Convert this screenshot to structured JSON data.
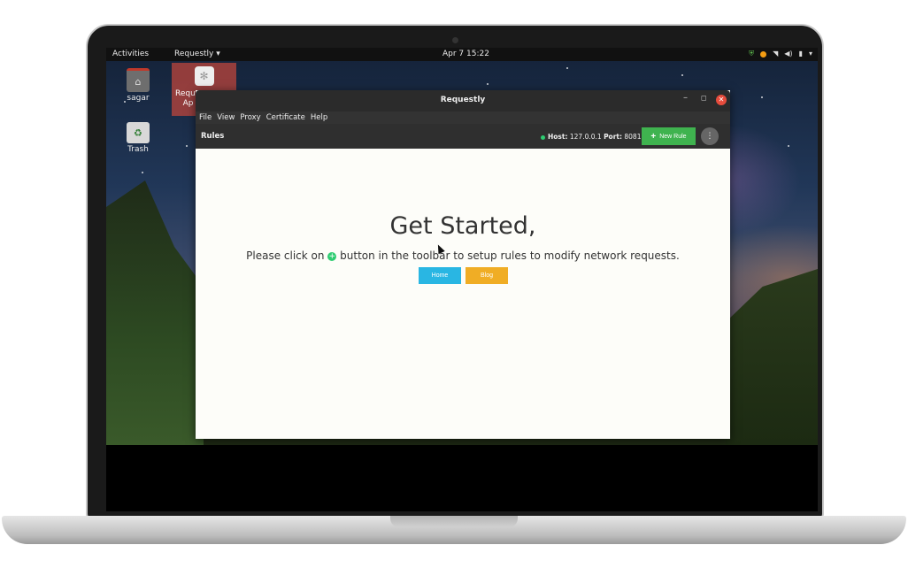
{
  "topbar": {
    "activities": "Activities",
    "app_menu": "Requestly ▾",
    "clock": "Apr 7  15:22"
  },
  "tray_icons": [
    "shield-icon",
    "orange-dot-icon",
    "wifi-icon",
    "volume-icon",
    "battery-icon",
    "chevron-down-icon"
  ],
  "desktop": {
    "icons": [
      {
        "label": "sagar",
        "icon": "home-folder-icon"
      },
      {
        "label": "Trash",
        "icon": "trash-icon"
      }
    ],
    "selected_icon": {
      "label": "Reque\nAp",
      "icon": "requestly-app-icon"
    }
  },
  "window": {
    "title": "Requestly",
    "menu": [
      "File",
      "View",
      "Proxy",
      "Certificate",
      "Help"
    ],
    "toolbar": {
      "section": "Rules",
      "host_label": "Host:",
      "host_value": "127.0.0.1",
      "port_label": "Port:",
      "port_value": "8081",
      "new_rule": "New Rule"
    },
    "content": {
      "heading": "Get Started,",
      "text_before": "Please click on",
      "text_after": "button in the toolbar to setup rules to modify network requests.",
      "home_button": "Home",
      "blog_button": "Blog"
    }
  },
  "colors": {
    "new_rule_green": "#3fb34f",
    "home_blue": "#29b6e3",
    "blog_orange": "#f0ad25",
    "close_red": "#e74c3c"
  }
}
